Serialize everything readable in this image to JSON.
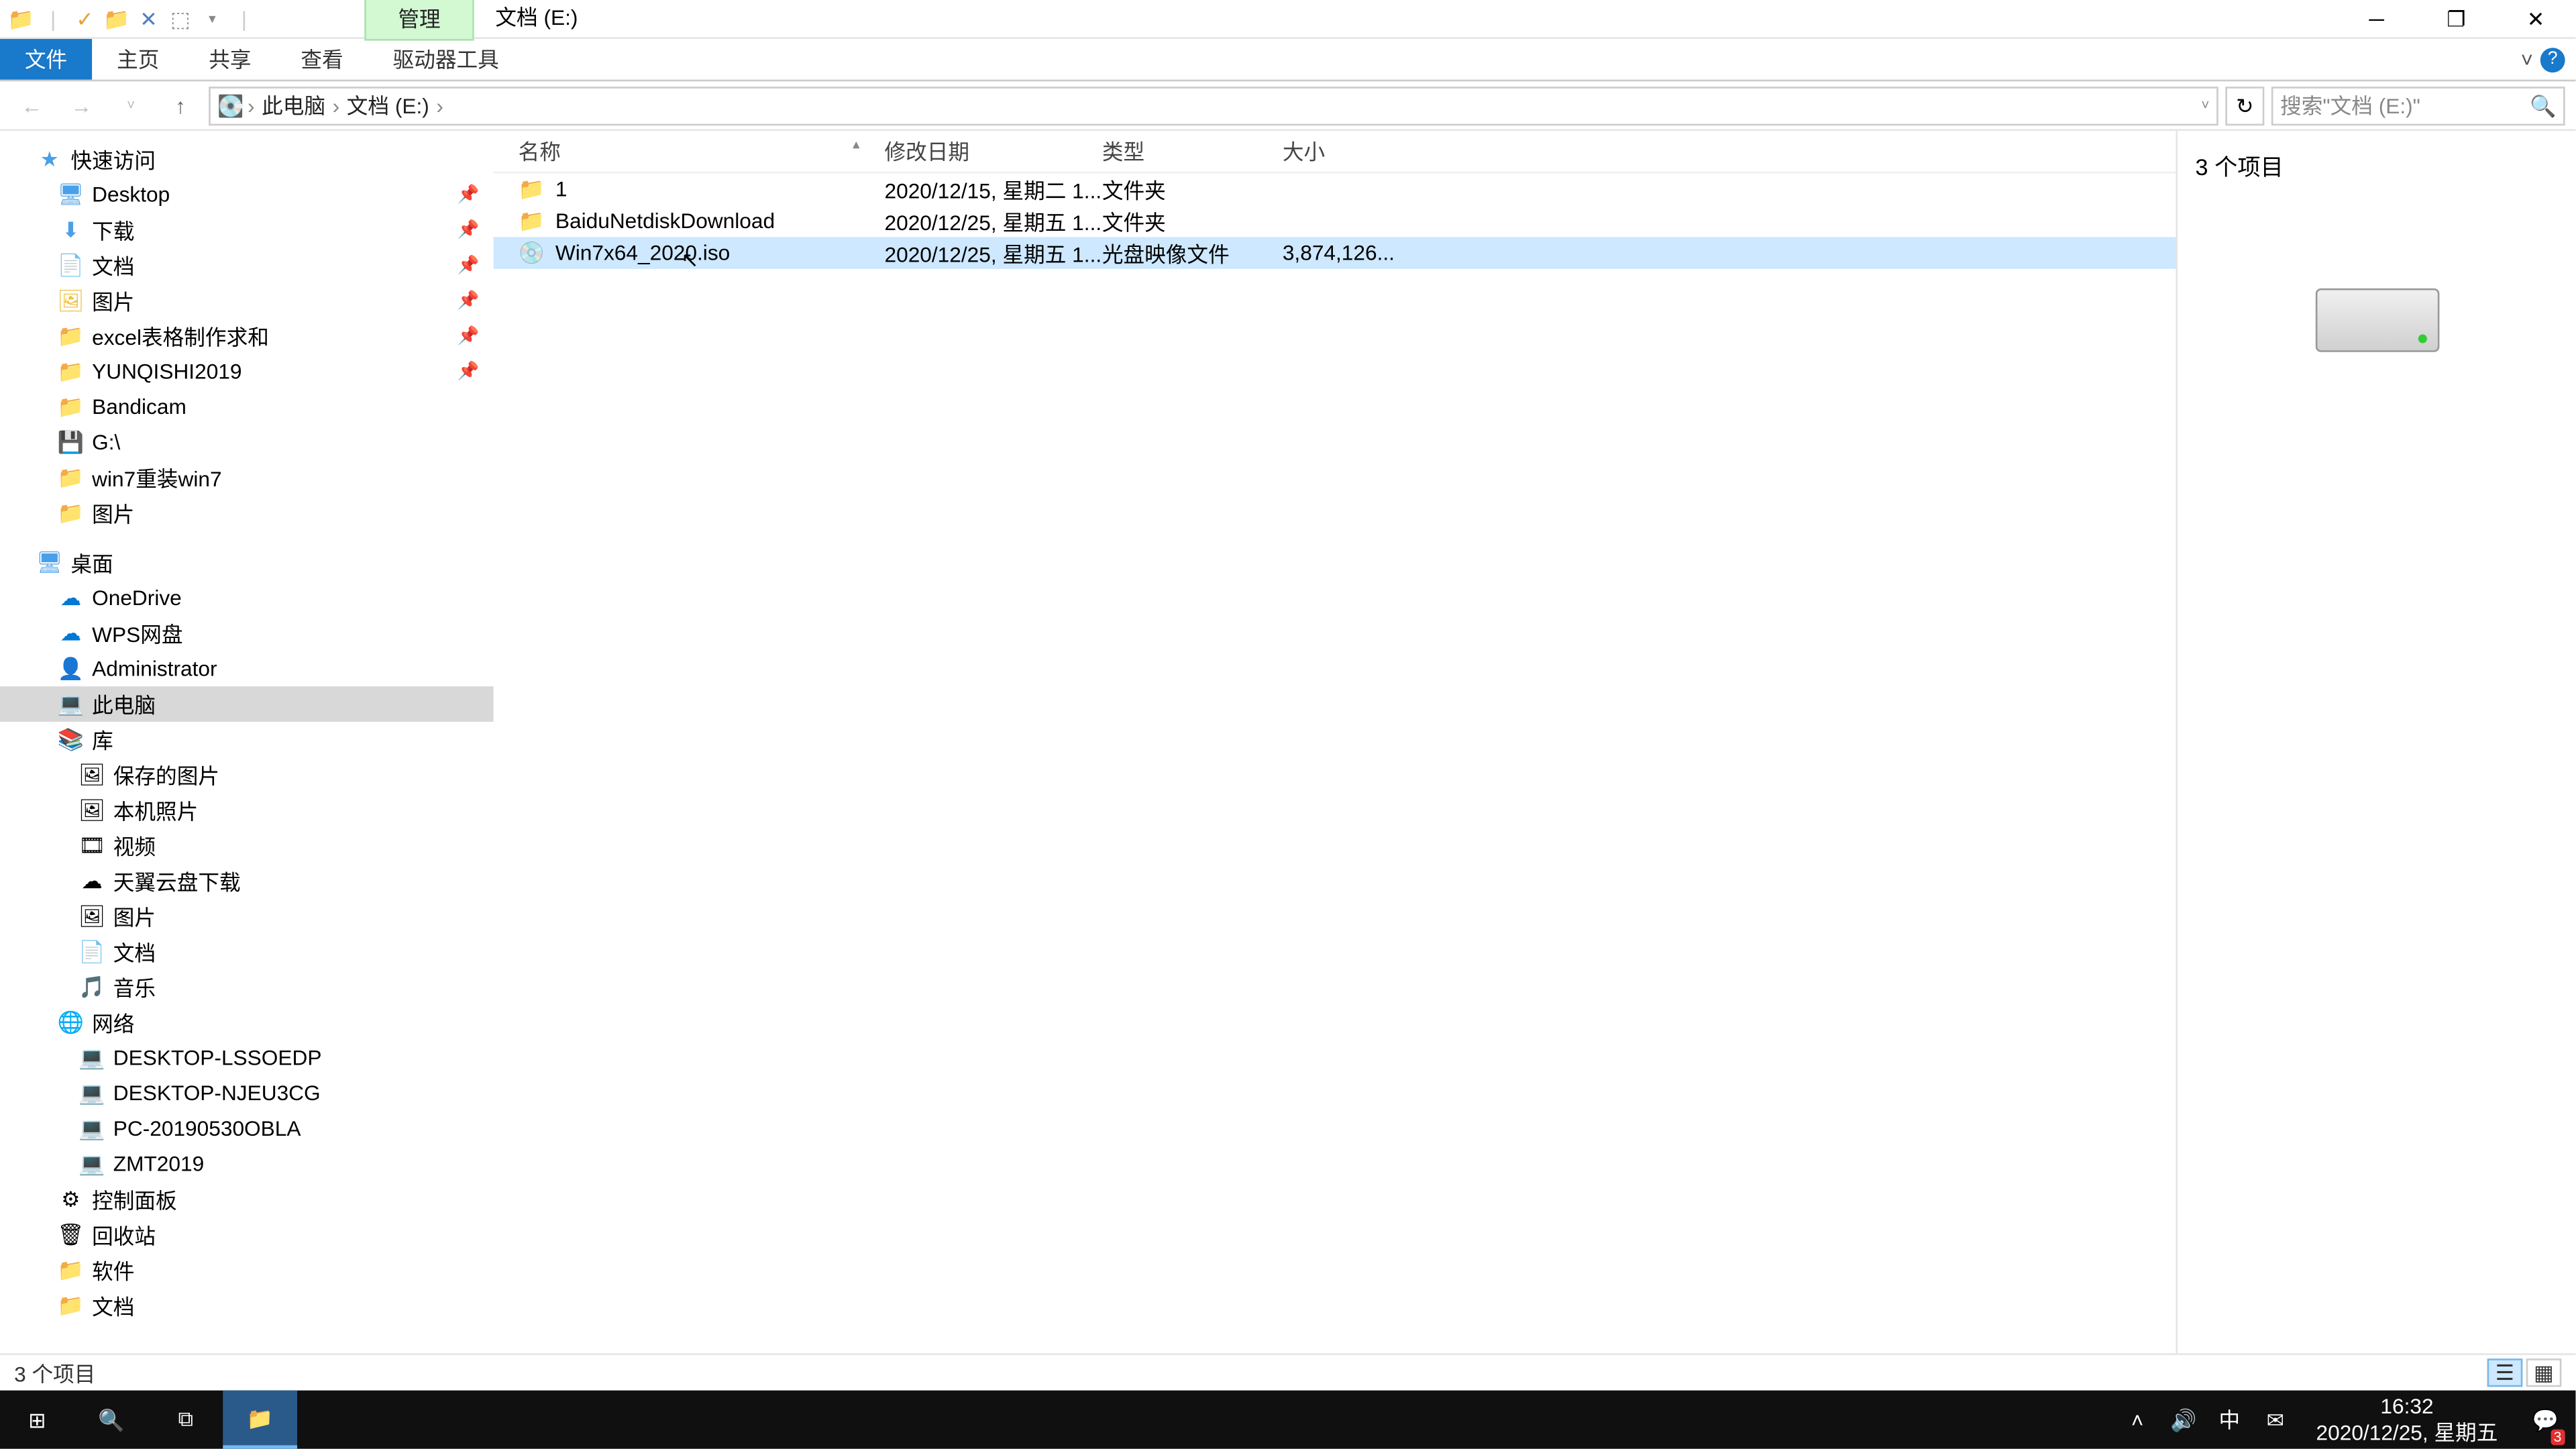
{
  "titlebar": {
    "manage_tab": "管理",
    "title": "文档 (E:)"
  },
  "ribbon": {
    "file": "文件",
    "home": "主页",
    "share": "共享",
    "view": "查看",
    "drive_tools": "驱动器工具"
  },
  "breadcrumb": {
    "pc": "此电脑",
    "location": "文档 (E:)"
  },
  "search": {
    "placeholder": "搜索\"文档 (E:)\""
  },
  "sidebar": {
    "quick_access": "快速访问",
    "pinned": [
      {
        "label": "Desktop"
      },
      {
        "label": "下载"
      },
      {
        "label": "文档"
      },
      {
        "label": "图片"
      },
      {
        "label": "excel表格制作求和"
      },
      {
        "label": "YUNQISHI2019"
      }
    ],
    "recent": [
      {
        "label": "Bandicam"
      },
      {
        "label": "G:\\"
      },
      {
        "label": "win7重装win7"
      },
      {
        "label": "图片"
      }
    ],
    "desktop": "桌面",
    "onedrive": "OneDrive",
    "wps": "WPS网盘",
    "admin": "Administrator",
    "this_pc": "此电脑",
    "library": "库",
    "lib_items": [
      "保存的图片",
      "本机照片",
      "视频",
      "天翼云盘下载",
      "图片",
      "文档",
      "音乐"
    ],
    "network": "网络",
    "net_items": [
      "DESKTOP-LSSOEDP",
      "DESKTOP-NJEU3CG",
      "PC-20190530OBLA",
      "ZMT2019"
    ],
    "control_panel": "控制面板",
    "recycle": "回收站",
    "software": "软件",
    "docs": "文档"
  },
  "columns": {
    "name": "名称",
    "date": "修改日期",
    "type": "类型",
    "size": "大小"
  },
  "files": [
    {
      "name": "1",
      "date": "2020/12/15, 星期二 1...",
      "type": "文件夹",
      "size": "",
      "icon": "folder"
    },
    {
      "name": "BaiduNetdiskDownload",
      "date": "2020/12/25, 星期五 1...",
      "type": "文件夹",
      "size": "",
      "icon": "folder"
    },
    {
      "name": "Win7x64_2020.iso",
      "date": "2020/12/25, 星期五 1...",
      "type": "光盘映像文件",
      "size": "3,874,126...",
      "icon": "file"
    }
  ],
  "preview": {
    "count": "3 个项目"
  },
  "status": {
    "text": "3 个项目"
  },
  "taskbar": {
    "time": "16:32",
    "date": "2020/12/25, 星期五",
    "ime": "中",
    "notif_count": "3"
  }
}
